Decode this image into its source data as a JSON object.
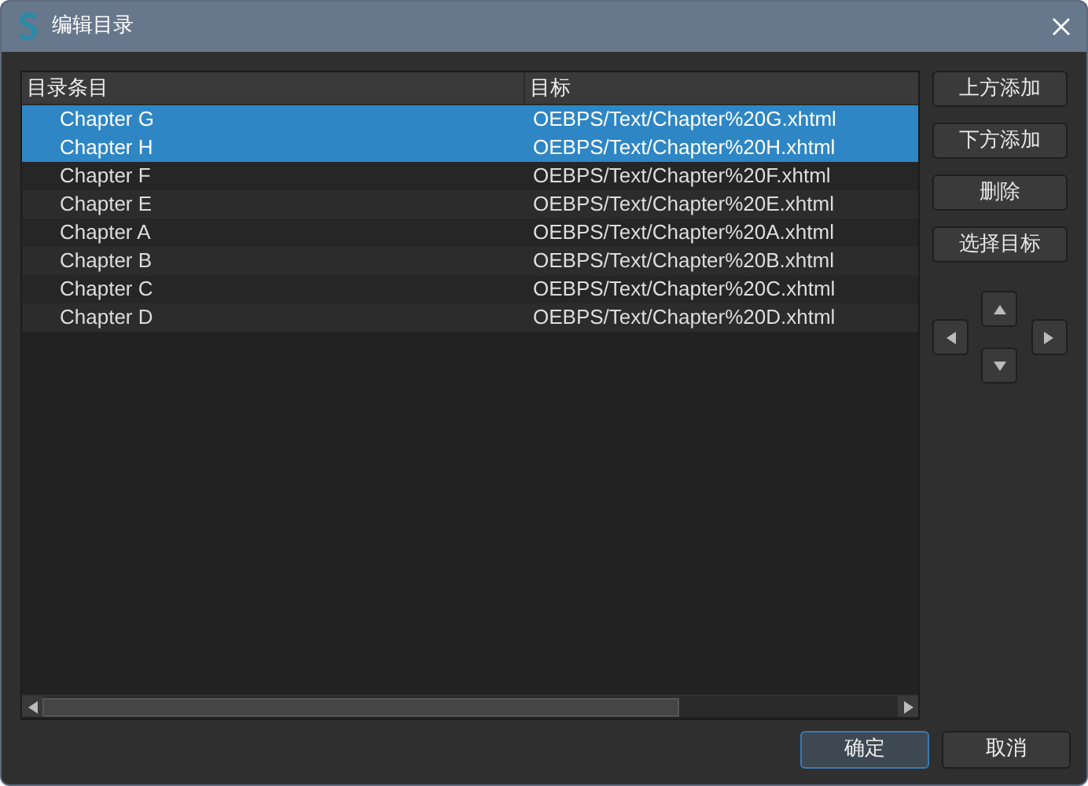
{
  "window": {
    "title": "编辑目录"
  },
  "table": {
    "columns": [
      "目录条目",
      "目标"
    ],
    "rows": [
      {
        "entry": "Chapter G",
        "target": "OEBPS/Text/Chapter%20G.xhtml",
        "selected": true
      },
      {
        "entry": "Chapter H",
        "target": "OEBPS/Text/Chapter%20H.xhtml",
        "selected": true
      },
      {
        "entry": "Chapter F",
        "target": "OEBPS/Text/Chapter%20F.xhtml",
        "selected": false
      },
      {
        "entry": "Chapter E",
        "target": "OEBPS/Text/Chapter%20E.xhtml",
        "selected": false
      },
      {
        "entry": "Chapter A",
        "target": "OEBPS/Text/Chapter%20A.xhtml",
        "selected": false
      },
      {
        "entry": "Chapter B",
        "target": "OEBPS/Text/Chapter%20B.xhtml",
        "selected": false
      },
      {
        "entry": "Chapter C",
        "target": "OEBPS/Text/Chapter%20C.xhtml",
        "selected": false
      },
      {
        "entry": "Chapter D",
        "target": "OEBPS/Text/Chapter%20D.xhtml",
        "selected": false
      }
    ]
  },
  "side_buttons": [
    "上方添加",
    "下方添加",
    "删除",
    "选择目标"
  ],
  "dialog_buttons": [
    {
      "label": "确定",
      "selected": true
    },
    {
      "label": "取消",
      "selected": false
    }
  ]
}
